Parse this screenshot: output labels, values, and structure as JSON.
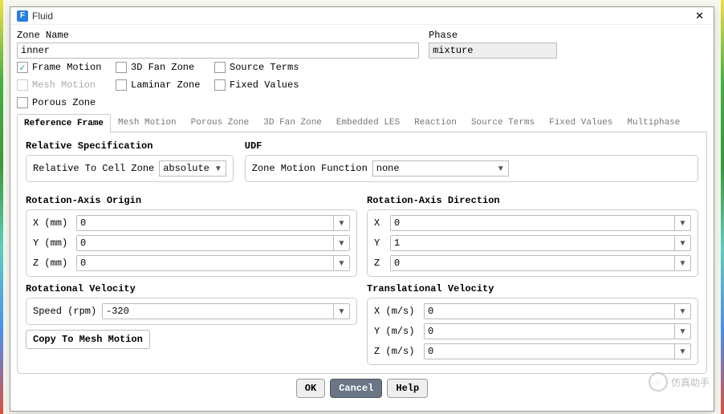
{
  "window": {
    "title": "Fluid",
    "icon_letter": "F"
  },
  "zone": {
    "name_label": "Zone Name",
    "name_value": "inner",
    "phase_label": "Phase",
    "phase_value": "mixture"
  },
  "checks": {
    "frame_motion": {
      "label": "Frame Motion",
      "checked": true,
      "enabled": true
    },
    "three_d_fan": {
      "label": "3D Fan Zone",
      "checked": false,
      "enabled": true
    },
    "source_terms": {
      "label": "Source Terms",
      "checked": false,
      "enabled": true
    },
    "mesh_motion": {
      "label": "Mesh Motion",
      "checked": false,
      "enabled": false
    },
    "laminar_zone": {
      "label": "Laminar Zone",
      "checked": false,
      "enabled": true
    },
    "fixed_values": {
      "label": "Fixed Values",
      "checked": false,
      "enabled": true
    },
    "porous_zone": {
      "label": "Porous Zone",
      "checked": false,
      "enabled": true
    }
  },
  "tabs": [
    "Reference Frame",
    "Mesh Motion",
    "Porous Zone",
    "3D Fan Zone",
    "Embedded LES",
    "Reaction",
    "Source Terms",
    "Fixed Values",
    "Multiphase"
  ],
  "relative_spec": {
    "title": "Relative Specification",
    "label": "Relative To Cell Zone",
    "value": "absolute"
  },
  "udf": {
    "title": "UDF",
    "label": "Zone Motion Function",
    "value": "none"
  },
  "rot_origin": {
    "title": "Rotation-Axis Origin",
    "x_label": "X (mm)",
    "x_value": "0",
    "y_label": "Y (mm)",
    "y_value": "0",
    "z_label": "Z (mm)",
    "z_value": "0"
  },
  "rot_dir": {
    "title": "Rotation-Axis Direction",
    "x_label": "X",
    "x_value": "0",
    "y_label": "Y",
    "y_value": "1",
    "z_label": "Z",
    "z_value": "0"
  },
  "rot_vel": {
    "title": "Rotational Velocity",
    "speed_label": "Speed (rpm)",
    "speed_value": "-320",
    "copy_btn": "Copy To Mesh Motion"
  },
  "trans_vel": {
    "title": "Translational Velocity",
    "x_label": "X (m/s)",
    "x_value": "0",
    "y_label": "Y (m/s)",
    "y_value": "0",
    "z_label": "Z (m/s)",
    "z_value": "0"
  },
  "footer": {
    "ok": "OK",
    "cancel": "Cancel",
    "help": "Help"
  },
  "watermark": "仿真助手"
}
